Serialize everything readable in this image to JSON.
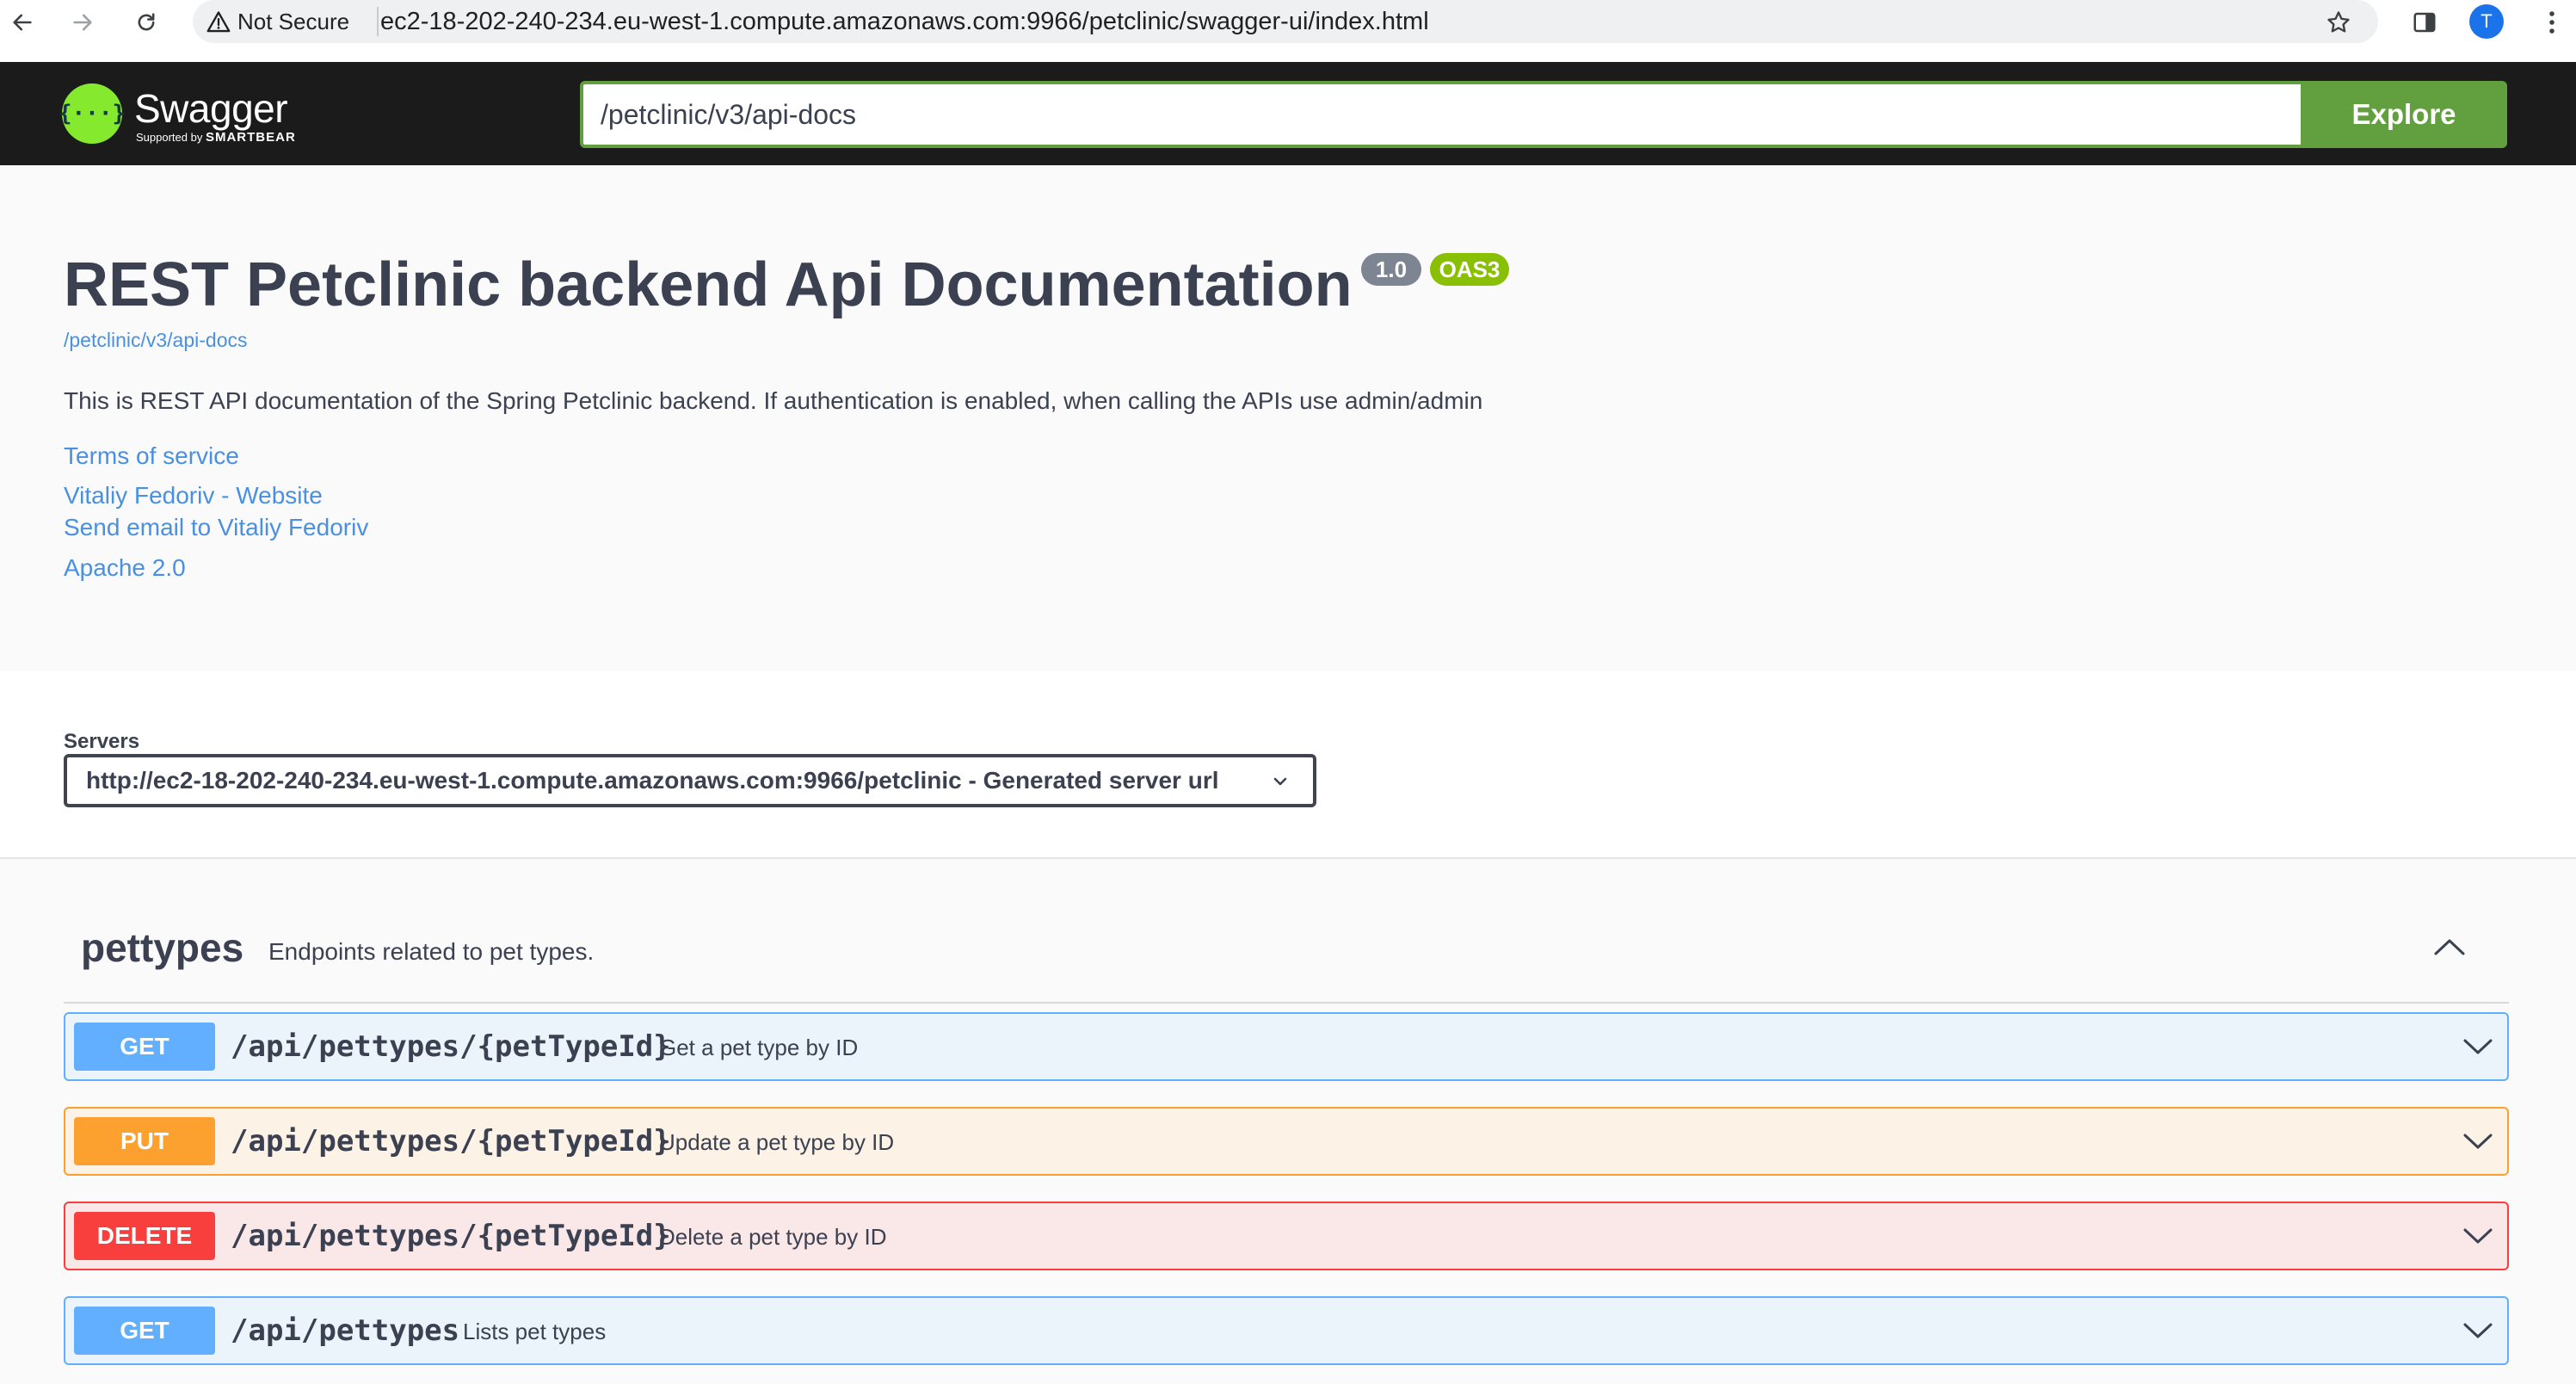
{
  "browser": {
    "security_label": "Not Secure",
    "url": "ec2-18-202-240-234.eu-west-1.compute.amazonaws.com:9966/petclinic/swagger-ui/index.html",
    "profile_initial": "T"
  },
  "topbar": {
    "logo_word": "Swagger",
    "logo_sub_small": "Supported by",
    "logo_sub_brand": "SMARTBEAR",
    "logo_glyph": "{···}",
    "spec_input_value": "/petclinic/v3/api-docs",
    "explore_label": "Explore"
  },
  "info": {
    "title": "REST Petclinic backend Api Documentation",
    "version_badge": "1.0",
    "oas_badge": "OAS3",
    "spec_link": "/petclinic/v3/api-docs",
    "description": "This is REST API documentation of the Spring Petclinic backend. If authentication is enabled, when calling the APIs use admin/admin",
    "links": {
      "terms": "Terms of service",
      "website": "Vitaliy Fedoriv - Website",
      "email": "Send email to Vitaliy Fedoriv",
      "license": "Apache 2.0"
    }
  },
  "servers": {
    "label": "Servers",
    "selected": "http://ec2-18-202-240-234.eu-west-1.compute.amazonaws.com:9966/petclinic - Generated server url"
  },
  "tag": {
    "name": "pettypes",
    "description": "Endpoints related to pet types."
  },
  "operations": [
    {
      "method": "GET",
      "path": "/api/pettypes/{petTypeId}",
      "summary": "Get a pet type by ID"
    },
    {
      "method": "PUT",
      "path": "/api/pettypes/{petTypeId}",
      "summary": "Update a pet type by ID"
    },
    {
      "method": "DELETE",
      "path": "/api/pettypes/{petTypeId}",
      "summary": "Delete a pet type by ID"
    },
    {
      "method": "GET",
      "path": "/api/pettypes",
      "summary": "Lists pet types"
    }
  ],
  "colors": {
    "get": "#61affe",
    "put": "#fca130",
    "delete": "#f93e3e",
    "swagger_green": "#85ea2d",
    "explore_green": "#62a03f",
    "link_blue": "#4990e2",
    "oas_badge": "#89bf04"
  },
  "icons": {
    "back": "arrow-left-icon",
    "forward": "arrow-right-icon",
    "reload": "reload-icon",
    "warning": "warning-triangle-icon",
    "bookmark": "star-icon",
    "side_panel": "side-panel-icon",
    "menu": "kebab-menu-icon",
    "collapse": "chevron-up-icon",
    "expand": "chevron-down-icon"
  }
}
